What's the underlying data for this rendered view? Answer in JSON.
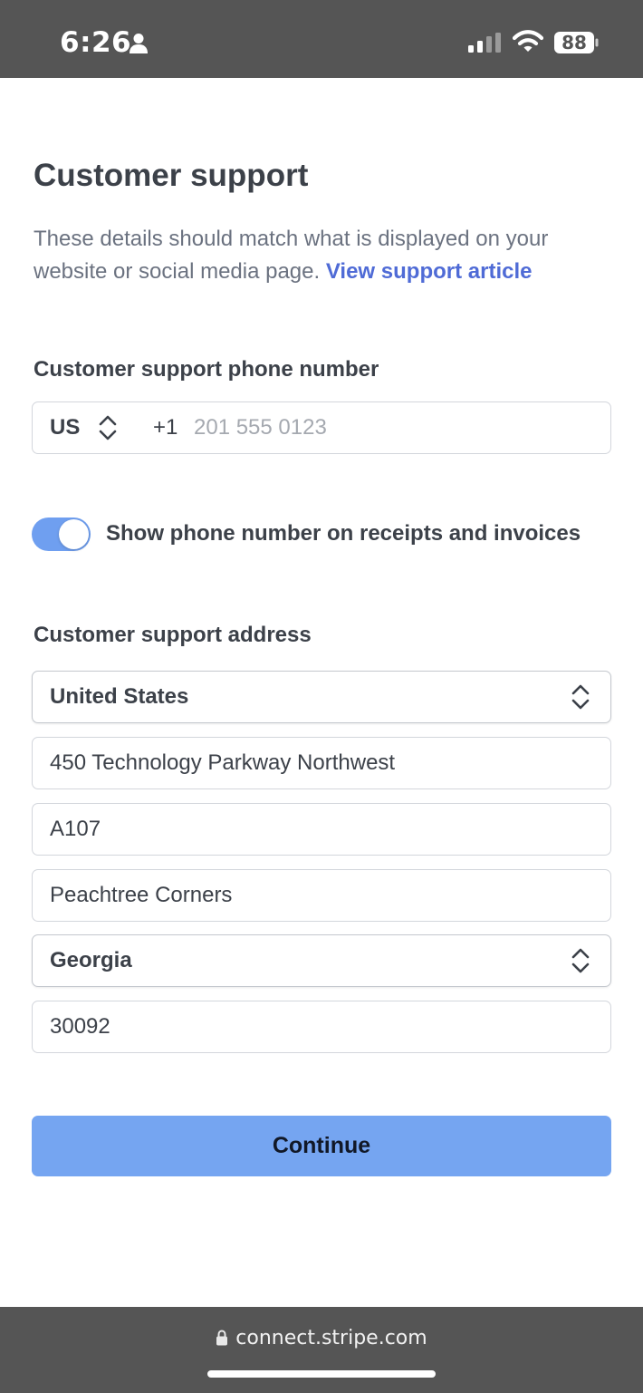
{
  "status_bar": {
    "time": "6:26",
    "battery": "88"
  },
  "page": {
    "title": "Customer support",
    "description": "These details should match what is displayed on your website or social media page.",
    "link_text": "View support article"
  },
  "phone": {
    "label": "Customer support phone number",
    "country_code": "US",
    "dial_code": "+1",
    "placeholder": "201 555 0123",
    "value": ""
  },
  "toggle": {
    "label": "Show phone number on receipts and invoices",
    "enabled": true
  },
  "address": {
    "label": "Customer support address",
    "country": "United States",
    "line1": "450 Technology Parkway Northwest",
    "line2": "A107",
    "city": "Peachtree Corners",
    "state": "Georgia",
    "zip": "30092"
  },
  "actions": {
    "continue_label": "Continue"
  },
  "browser": {
    "url": "connect.stripe.com"
  },
  "colors": {
    "accent": "#75a5f1",
    "link": "#4f6bd6",
    "toggle_on": "#6f9ff0",
    "chrome": "#555555"
  }
}
